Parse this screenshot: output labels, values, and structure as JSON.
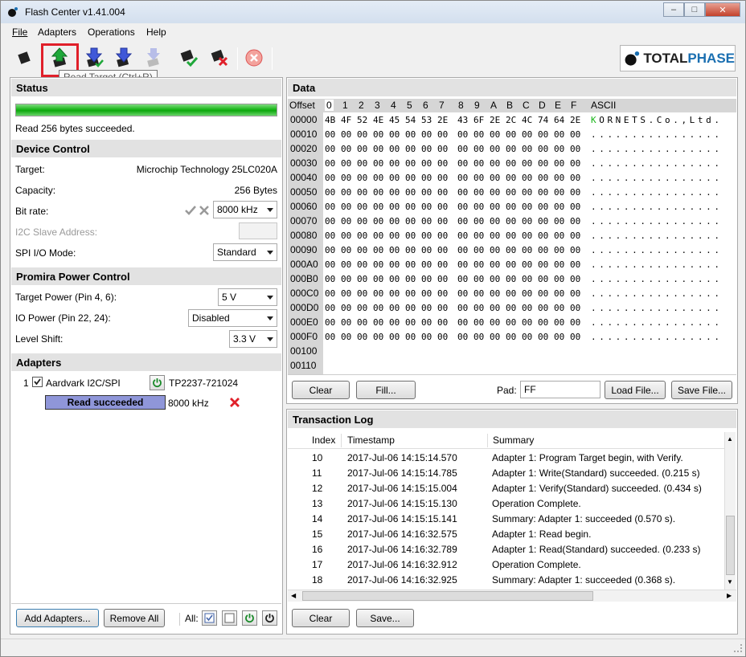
{
  "window": {
    "title": "Flash Center v1.41.004"
  },
  "menu": [
    "File",
    "Adapters",
    "Operations",
    "Help"
  ],
  "tooltip": "Read Target   (Ctrl+R)",
  "logo": {
    "part1": "TOTAL",
    "part2": "PHASE"
  },
  "status": {
    "header": "Status",
    "progress_percent": 100,
    "message": "Read 256 bytes succeeded."
  },
  "device_control": {
    "header": "Device Control",
    "target_label": "Target:",
    "target_value": "Microchip Technology 25LC020A",
    "capacity_label": "Capacity:",
    "capacity_value": "256 Bytes",
    "bitrate_label": "Bit rate:",
    "bitrate_value": "8000 kHz",
    "i2c_label": "I2C Slave Address:",
    "spi_label": "SPI I/O Mode:",
    "spi_value": "Standard"
  },
  "power": {
    "header": "Promira Power Control",
    "target_power_label": "Target Power (Pin 4, 6):",
    "target_power_value": "5 V",
    "io_power_label": "IO Power (Pin 22, 24):",
    "io_power_value": "Disabled",
    "level_shift_label": "Level Shift:",
    "level_shift_value": "3.3 V"
  },
  "adapters": {
    "header": "Adapters",
    "index": "1",
    "name": "Aardvark I2C/SPI",
    "serial": "TP2237-721024",
    "state": "Read succeeded",
    "speed": "8000 kHz",
    "add_button": "Add Adapters...",
    "remove_button": "Remove All",
    "all_label": "All:"
  },
  "data": {
    "header": "Data",
    "offset_header": "Offset",
    "hex_headers": [
      "0",
      "1",
      "2",
      "3",
      "4",
      "5",
      "6",
      "7",
      "8",
      "9",
      "A",
      "B",
      "C",
      "D",
      "E",
      "F"
    ],
    "ascii_header": "ASCII",
    "rows": [
      {
        "offset": "00000",
        "bytes": [
          "4B",
          "4F",
          "52",
          "4E",
          "45",
          "54",
          "53",
          "2E",
          "43",
          "6F",
          "2E",
          "2C",
          "4C",
          "74",
          "64",
          "2E"
        ],
        "ascii": "KORNETS.Co.,Ltd."
      },
      {
        "offset": "00010",
        "bytes": [
          "00",
          "00",
          "00",
          "00",
          "00",
          "00",
          "00",
          "00",
          "00",
          "00",
          "00",
          "00",
          "00",
          "00",
          "00",
          "00"
        ],
        "ascii": "................"
      },
      {
        "offset": "00020",
        "bytes": [
          "00",
          "00",
          "00",
          "00",
          "00",
          "00",
          "00",
          "00",
          "00",
          "00",
          "00",
          "00",
          "00",
          "00",
          "00",
          "00"
        ],
        "ascii": "................"
      },
      {
        "offset": "00030",
        "bytes": [
          "00",
          "00",
          "00",
          "00",
          "00",
          "00",
          "00",
          "00",
          "00",
          "00",
          "00",
          "00",
          "00",
          "00",
          "00",
          "00"
        ],
        "ascii": "................"
      },
      {
        "offset": "00040",
        "bytes": [
          "00",
          "00",
          "00",
          "00",
          "00",
          "00",
          "00",
          "00",
          "00",
          "00",
          "00",
          "00",
          "00",
          "00",
          "00",
          "00"
        ],
        "ascii": "................"
      },
      {
        "offset": "00050",
        "bytes": [
          "00",
          "00",
          "00",
          "00",
          "00",
          "00",
          "00",
          "00",
          "00",
          "00",
          "00",
          "00",
          "00",
          "00",
          "00",
          "00"
        ],
        "ascii": "................"
      },
      {
        "offset": "00060",
        "bytes": [
          "00",
          "00",
          "00",
          "00",
          "00",
          "00",
          "00",
          "00",
          "00",
          "00",
          "00",
          "00",
          "00",
          "00",
          "00",
          "00"
        ],
        "ascii": "................"
      },
      {
        "offset": "00070",
        "bytes": [
          "00",
          "00",
          "00",
          "00",
          "00",
          "00",
          "00",
          "00",
          "00",
          "00",
          "00",
          "00",
          "00",
          "00",
          "00",
          "00"
        ],
        "ascii": "................"
      },
      {
        "offset": "00080",
        "bytes": [
          "00",
          "00",
          "00",
          "00",
          "00",
          "00",
          "00",
          "00",
          "00",
          "00",
          "00",
          "00",
          "00",
          "00",
          "00",
          "00"
        ],
        "ascii": "................"
      },
      {
        "offset": "00090",
        "bytes": [
          "00",
          "00",
          "00",
          "00",
          "00",
          "00",
          "00",
          "00",
          "00",
          "00",
          "00",
          "00",
          "00",
          "00",
          "00",
          "00"
        ],
        "ascii": "................"
      },
      {
        "offset": "000A0",
        "bytes": [
          "00",
          "00",
          "00",
          "00",
          "00",
          "00",
          "00",
          "00",
          "00",
          "00",
          "00",
          "00",
          "00",
          "00",
          "00",
          "00"
        ],
        "ascii": "................"
      },
      {
        "offset": "000B0",
        "bytes": [
          "00",
          "00",
          "00",
          "00",
          "00",
          "00",
          "00",
          "00",
          "00",
          "00",
          "00",
          "00",
          "00",
          "00",
          "00",
          "00"
        ],
        "ascii": "................"
      },
      {
        "offset": "000C0",
        "bytes": [
          "00",
          "00",
          "00",
          "00",
          "00",
          "00",
          "00",
          "00",
          "00",
          "00",
          "00",
          "00",
          "00",
          "00",
          "00",
          "00"
        ],
        "ascii": "................"
      },
      {
        "offset": "000D0",
        "bytes": [
          "00",
          "00",
          "00",
          "00",
          "00",
          "00",
          "00",
          "00",
          "00",
          "00",
          "00",
          "00",
          "00",
          "00",
          "00",
          "00"
        ],
        "ascii": "................"
      },
      {
        "offset": "000E0",
        "bytes": [
          "00",
          "00",
          "00",
          "00",
          "00",
          "00",
          "00",
          "00",
          "00",
          "00",
          "00",
          "00",
          "00",
          "00",
          "00",
          "00"
        ],
        "ascii": "................"
      },
      {
        "offset": "000F0",
        "bytes": [
          "00",
          "00",
          "00",
          "00",
          "00",
          "00",
          "00",
          "00",
          "00",
          "00",
          "00",
          "00",
          "00",
          "00",
          "00",
          "00"
        ],
        "ascii": "................"
      },
      {
        "offset": "00100",
        "bytes": [],
        "ascii": ""
      },
      {
        "offset": "00110",
        "bytes": [],
        "ascii": ""
      }
    ],
    "clear_button": "Clear",
    "fill_button": "Fill...",
    "pad_label": "Pad:",
    "pad_value": "FF",
    "load_button": "Load File...",
    "save_button": "Save File..."
  },
  "log": {
    "header": "Transaction Log",
    "columns": [
      "Index",
      "Timestamp",
      "Summary"
    ],
    "rows": [
      {
        "index": "10",
        "time": "2017-Jul-06 14:15:14.570",
        "summary": "Adapter 1: Program Target begin, with Verify."
      },
      {
        "index": "11",
        "time": "2017-Jul-06 14:15:14.785",
        "summary": "Adapter 1: Write(Standard) succeeded. (0.215 s)"
      },
      {
        "index": "12",
        "time": "2017-Jul-06 14:15:15.004",
        "summary": "Adapter 1: Verify(Standard) succeeded. (0.434 s)"
      },
      {
        "index": "13",
        "time": "2017-Jul-06 14:15:15.130",
        "summary": "Operation Complete."
      },
      {
        "index": "14",
        "time": "2017-Jul-06 14:15:15.141",
        "summary": "Summary: Adapter 1: succeeded (0.570 s)."
      },
      {
        "index": "15",
        "time": "2017-Jul-06 14:16:32.575",
        "summary": "Adapter 1: Read begin."
      },
      {
        "index": "16",
        "time": "2017-Jul-06 14:16:32.789",
        "summary": "Adapter 1: Read(Standard) succeeded. (0.233 s)"
      },
      {
        "index": "17",
        "time": "2017-Jul-06 14:16:32.912",
        "summary": "Operation Complete."
      },
      {
        "index": "18",
        "time": "2017-Jul-06 14:16:32.925",
        "summary": "Summary: Adapter 1: succeeded (0.368 s)."
      }
    ],
    "clear_button": "Clear",
    "save_button": "Save..."
  },
  "colors": {
    "accent_green": "#19b619",
    "error_red": "#e0202a",
    "adapter_state_bg": "#8f96d9"
  }
}
